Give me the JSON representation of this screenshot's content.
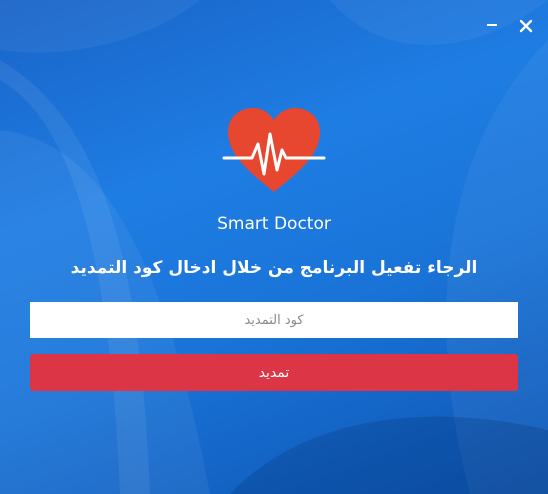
{
  "window": {
    "minimize_icon": "minimize-icon",
    "close_icon": "close-icon"
  },
  "app": {
    "logo_icon": "heart-pulse-icon",
    "name": "Smart Doctor"
  },
  "activation": {
    "prompt": "الرجاء تفعيل البرنامج من خلال ادخال كود التمديد",
    "code_placeholder": "كود التمديد",
    "code_value": "",
    "renew_label": "تمديد"
  },
  "colors": {
    "background": "#1a74d8",
    "heart": "#e8472f",
    "button": "#dc3545",
    "text": "#ffffff"
  }
}
